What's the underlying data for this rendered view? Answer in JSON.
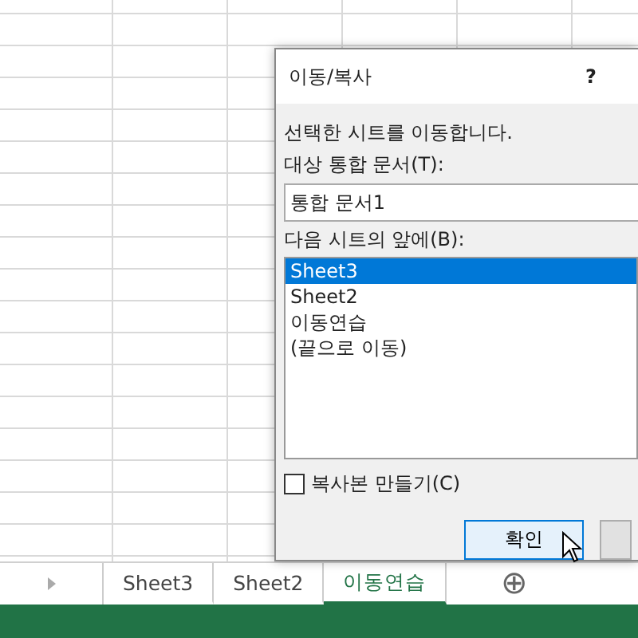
{
  "dialog": {
    "title": "이동/복사",
    "help": "?",
    "message": "선택한 시트를 이동합니다.",
    "target_label": "대상 통합 문서(T):",
    "target_value": "통합 문서1",
    "before_label": "다음 시트의 앞에(B):",
    "sheets_list": [
      {
        "label": "Sheet3",
        "selected": true
      },
      {
        "label": "Sheet2",
        "selected": false
      },
      {
        "label": "이동연습",
        "selected": false
      },
      {
        "label": "(끝으로 이동)",
        "selected": false
      }
    ],
    "copy_checkbox": {
      "label": "복사본 만들기(C)",
      "checked": false
    },
    "buttons": [
      {
        "label": "확인",
        "focused": true
      },
      {
        "focused": false
      }
    ]
  },
  "sheet_tabs": [
    {
      "label": "Sheet3",
      "selected": false
    },
    {
      "label": "Sheet2",
      "selected": false
    },
    {
      "label": "이동연습",
      "selected": true
    }
  ],
  "add_sheet": "⊕"
}
